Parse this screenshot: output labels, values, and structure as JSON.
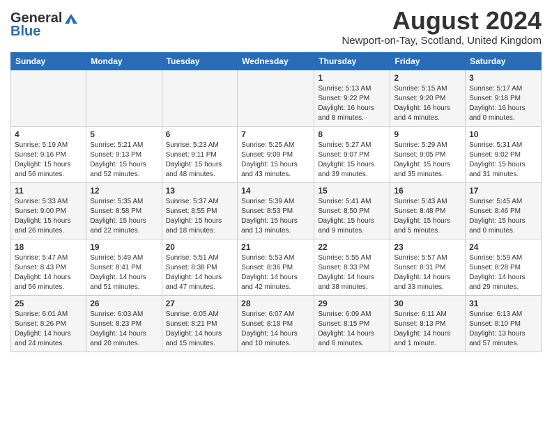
{
  "header": {
    "logo_general": "General",
    "logo_blue": "Blue",
    "main_title": "August 2024",
    "subtitle": "Newport-on-Tay, Scotland, United Kingdom"
  },
  "calendar": {
    "days_of_week": [
      "Sunday",
      "Monday",
      "Tuesday",
      "Wednesday",
      "Thursday",
      "Friday",
      "Saturday"
    ],
    "weeks": [
      [
        {
          "day": "",
          "info": ""
        },
        {
          "day": "",
          "info": ""
        },
        {
          "day": "",
          "info": ""
        },
        {
          "day": "",
          "info": ""
        },
        {
          "day": "1",
          "info": "Sunrise: 5:13 AM\nSunset: 9:22 PM\nDaylight: 16 hours\nand 8 minutes."
        },
        {
          "day": "2",
          "info": "Sunrise: 5:15 AM\nSunset: 9:20 PM\nDaylight: 16 hours\nand 4 minutes."
        },
        {
          "day": "3",
          "info": "Sunrise: 5:17 AM\nSunset: 9:18 PM\nDaylight: 16 hours\nand 0 minutes."
        }
      ],
      [
        {
          "day": "4",
          "info": "Sunrise: 5:19 AM\nSunset: 9:16 PM\nDaylight: 15 hours\nand 56 minutes."
        },
        {
          "day": "5",
          "info": "Sunrise: 5:21 AM\nSunset: 9:13 PM\nDaylight: 15 hours\nand 52 minutes."
        },
        {
          "day": "6",
          "info": "Sunrise: 5:23 AM\nSunset: 9:11 PM\nDaylight: 15 hours\nand 48 minutes."
        },
        {
          "day": "7",
          "info": "Sunrise: 5:25 AM\nSunset: 9:09 PM\nDaylight: 15 hours\nand 43 minutes."
        },
        {
          "day": "8",
          "info": "Sunrise: 5:27 AM\nSunset: 9:07 PM\nDaylight: 15 hours\nand 39 minutes."
        },
        {
          "day": "9",
          "info": "Sunrise: 5:29 AM\nSunset: 9:05 PM\nDaylight: 15 hours\nand 35 minutes."
        },
        {
          "day": "10",
          "info": "Sunrise: 5:31 AM\nSunset: 9:02 PM\nDaylight: 15 hours\nand 31 minutes."
        }
      ],
      [
        {
          "day": "11",
          "info": "Sunrise: 5:33 AM\nSunset: 9:00 PM\nDaylight: 15 hours\nand 26 minutes."
        },
        {
          "day": "12",
          "info": "Sunrise: 5:35 AM\nSunset: 8:58 PM\nDaylight: 15 hours\nand 22 minutes."
        },
        {
          "day": "13",
          "info": "Sunrise: 5:37 AM\nSunset: 8:55 PM\nDaylight: 15 hours\nand 18 minutes."
        },
        {
          "day": "14",
          "info": "Sunrise: 5:39 AM\nSunset: 8:53 PM\nDaylight: 15 hours\nand 13 minutes."
        },
        {
          "day": "15",
          "info": "Sunrise: 5:41 AM\nSunset: 8:50 PM\nDaylight: 15 hours\nand 9 minutes."
        },
        {
          "day": "16",
          "info": "Sunrise: 5:43 AM\nSunset: 8:48 PM\nDaylight: 15 hours\nand 5 minutes."
        },
        {
          "day": "17",
          "info": "Sunrise: 5:45 AM\nSunset: 8:46 PM\nDaylight: 15 hours\nand 0 minutes."
        }
      ],
      [
        {
          "day": "18",
          "info": "Sunrise: 5:47 AM\nSunset: 8:43 PM\nDaylight: 14 hours\nand 56 minutes."
        },
        {
          "day": "19",
          "info": "Sunrise: 5:49 AM\nSunset: 8:41 PM\nDaylight: 14 hours\nand 51 minutes."
        },
        {
          "day": "20",
          "info": "Sunrise: 5:51 AM\nSunset: 8:38 PM\nDaylight: 14 hours\nand 47 minutes."
        },
        {
          "day": "21",
          "info": "Sunrise: 5:53 AM\nSunset: 8:36 PM\nDaylight: 14 hours\nand 42 minutes."
        },
        {
          "day": "22",
          "info": "Sunrise: 5:55 AM\nSunset: 8:33 PM\nDaylight: 14 hours\nand 38 minutes."
        },
        {
          "day": "23",
          "info": "Sunrise: 5:57 AM\nSunset: 8:31 PM\nDaylight: 14 hours\nand 33 minutes."
        },
        {
          "day": "24",
          "info": "Sunrise: 5:59 AM\nSunset: 8:28 PM\nDaylight: 14 hours\nand 29 minutes."
        }
      ],
      [
        {
          "day": "25",
          "info": "Sunrise: 6:01 AM\nSunset: 8:26 PM\nDaylight: 14 hours\nand 24 minutes."
        },
        {
          "day": "26",
          "info": "Sunrise: 6:03 AM\nSunset: 8:23 PM\nDaylight: 14 hours\nand 20 minutes."
        },
        {
          "day": "27",
          "info": "Sunrise: 6:05 AM\nSunset: 8:21 PM\nDaylight: 14 hours\nand 15 minutes."
        },
        {
          "day": "28",
          "info": "Sunrise: 6:07 AM\nSunset: 8:18 PM\nDaylight: 14 hours\nand 10 minutes."
        },
        {
          "day": "29",
          "info": "Sunrise: 6:09 AM\nSunset: 8:15 PM\nDaylight: 14 hours\nand 6 minutes."
        },
        {
          "day": "30",
          "info": "Sunrise: 6:11 AM\nSunset: 8:13 PM\nDaylight: 14 hours\nand 1 minute."
        },
        {
          "day": "31",
          "info": "Sunrise: 6:13 AM\nSunset: 8:10 PM\nDaylight: 13 hours\nand 57 minutes."
        }
      ]
    ]
  }
}
